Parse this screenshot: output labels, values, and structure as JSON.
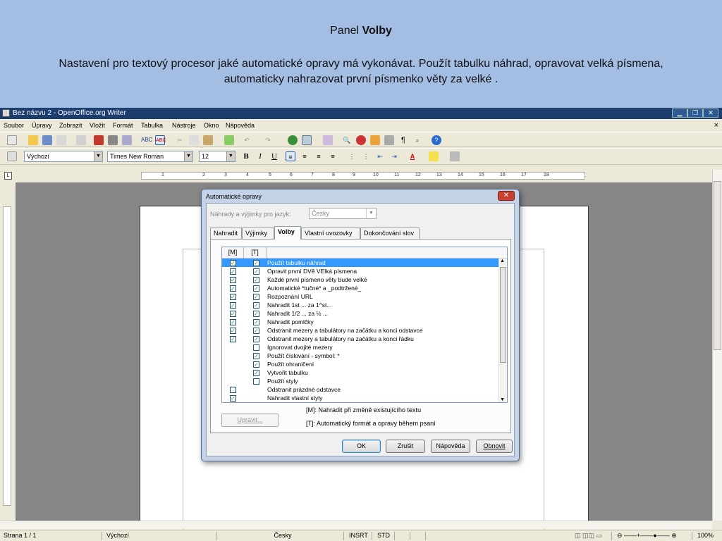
{
  "slide": {
    "title_prefix": "Panel ",
    "title_bold": "Volby",
    "description": "Nastavení pro textový procesor jaké automatické opravy má vykonávat. Použít tabulku náhrad, opravovat velká písmena, automaticky nahrazovat první písmenko věty za velké ."
  },
  "window": {
    "title": "Bez názvu 2 - OpenOffice.org Writer",
    "menu": [
      "Soubor",
      "Úpravy",
      "Zobrazit",
      "Vložit",
      "Formát",
      "Tabulka",
      "Nástroje",
      "Okno",
      "Nápověda"
    ],
    "style_combo": "Výchozí",
    "font_combo": "Times New Roman",
    "size_combo": "12",
    "ruler_ticks": [
      "1",
      "2",
      "3",
      "4",
      "5",
      "6",
      "7",
      "8",
      "9",
      "10",
      "11",
      "12",
      "13",
      "14",
      "15",
      "16",
      "17",
      "18"
    ]
  },
  "status": {
    "page": "Strana 1 / 1",
    "style": "Výchozí",
    "language": "Česky",
    "insert": "INSRT",
    "selection": "STD",
    "zoom": "100%"
  },
  "dialog": {
    "title": "Automatické opravy",
    "lang_label": "Náhrady a výjimky pro jazyk:",
    "lang_value": "Česky",
    "tabs": [
      "Nahradit",
      "Výjimky",
      "Volby",
      "Vlastní uvozovky",
      "Dokončování slov"
    ],
    "active_tab": "Volby",
    "col_m": "[M]",
    "col_t": "[T]",
    "options": [
      {
        "label": "Použít tabulku náhrad",
        "m": true,
        "t": true,
        "selected": true
      },
      {
        "label": "Opravit první DVě VElká písmena",
        "m": true,
        "t": true
      },
      {
        "label": "Každé první písmeno věty bude velké",
        "m": true,
        "t": true
      },
      {
        "label": "Automatické *tučné* a _podtržené_",
        "m": true,
        "t": true
      },
      {
        "label": "Rozpoznání URL",
        "m": true,
        "t": true
      },
      {
        "label": "Nahradit 1st ... za 1^st...",
        "m": true,
        "t": true
      },
      {
        "label": "Nahradit 1/2 ... za ½ ...",
        "m": true,
        "t": true
      },
      {
        "label": "Nahradit pomlčky",
        "m": true,
        "t": true
      },
      {
        "label": "Odstranit mezery a tabulátory na začátku a konci odstavce",
        "m": true,
        "t": true
      },
      {
        "label": "Odstranit mezery a tabulátory na začátku a konci řádku",
        "m": true,
        "t": true
      },
      {
        "label": "Ignorovat dvojité mezery",
        "m": null,
        "t": false
      },
      {
        "label": "Použít číslování - symbol: *",
        "m": null,
        "t": true
      },
      {
        "label": "Použít ohraničení",
        "m": null,
        "t": true
      },
      {
        "label": "Vytvořit tabulku",
        "m": null,
        "t": true
      },
      {
        "label": "Použít styly",
        "m": null,
        "t": false
      },
      {
        "label": "Odstranit prázdné odstavce",
        "m": false,
        "t": null
      },
      {
        "label": "Nahradit vlastní styly",
        "m": true,
        "t": null
      }
    ],
    "edit_button": "Upravit...",
    "legend_m": "[M]: Nahradit při změně existujícího textu",
    "legend_t": "[T]: Automatický formát a opravy během psaní",
    "ok": "OK",
    "cancel": "Zrušit",
    "help": "Nápověda",
    "reset": "Obnovit"
  }
}
